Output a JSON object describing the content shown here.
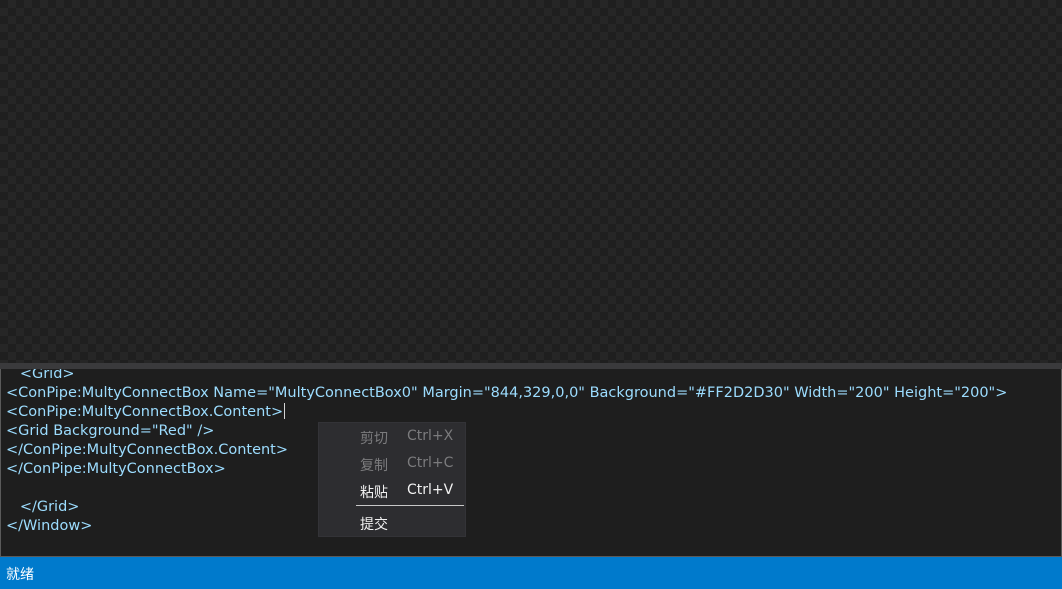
{
  "editor": {
    "lines": [
      "   <Grid>",
      "<ConPipe:MultyConnectBox Name=\"MultyConnectBox0\" Margin=\"844,329,0,0\" Background=\"#FF2D2D30\" Width=\"200\" Height=\"200\">",
      "<ConPipe:MultyConnectBox.Content>",
      "<Grid Background=\"Red\" />",
      "</ConPipe:MultyConnectBox.Content>",
      "</ConPipe:MultyConnectBox>",
      "",
      "   </Grid>",
      "</Window>"
    ],
    "text_color": "#9cdcfe"
  },
  "context_menu": {
    "items": [
      {
        "label": "剪切",
        "shortcut": "Ctrl+X",
        "enabled": false
      },
      {
        "label": "复制",
        "shortcut": "Ctrl+C",
        "enabled": false
      },
      {
        "label": "粘贴",
        "shortcut": "Ctrl+V",
        "enabled": true
      },
      {
        "label": "提交",
        "shortcut": "",
        "enabled": true
      }
    ]
  },
  "status_bar": {
    "text": "就绪",
    "color": "#007acc"
  }
}
